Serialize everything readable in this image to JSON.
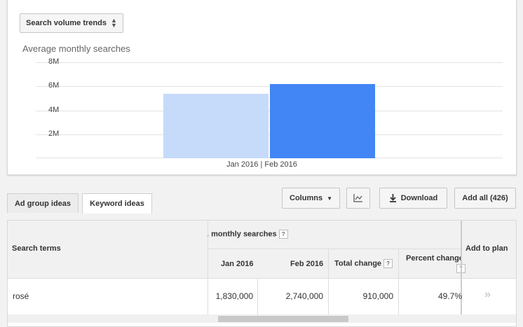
{
  "chart_panel": {
    "selector_label": "Search volume trends",
    "title": "Average monthly searches"
  },
  "chart_data": {
    "type": "bar",
    "categories": [
      "Jan 2016",
      "Feb 2016"
    ],
    "values": [
      5400000,
      6200000
    ],
    "colors": [
      "#c6dafa",
      "#4285f4"
    ],
    "ylim": [
      0,
      8000000
    ],
    "yticks": [
      "2M",
      "4M",
      "6M",
      "8M"
    ],
    "xlabel": "Jan 2016 | Feb 2016"
  },
  "tabs": [
    {
      "label": "Ad group ideas"
    },
    {
      "label": "Keyword ideas"
    }
  ],
  "toolbar": {
    "columns_label": "Columns",
    "download_label": "Download",
    "add_all_label": "Add all (426)"
  },
  "table": {
    "group_header": ". monthly searches",
    "headers": {
      "search_terms": "Search terms",
      "jan": "Jan 2016",
      "feb": "Feb 2016",
      "total_change": "Total change",
      "percent_change": "Percent change",
      "add_to_plan": "Add to plan"
    },
    "rows": [
      {
        "term": "rosé",
        "jan": "1,830,000",
        "feb": "2,740,000",
        "total_change": "910,000",
        "percent_change": "49.7%"
      }
    ]
  }
}
